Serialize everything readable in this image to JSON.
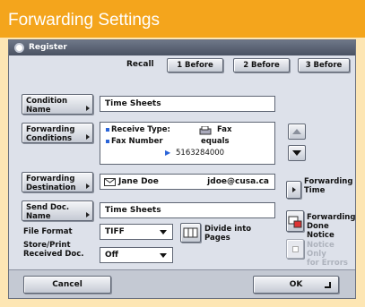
{
  "page_title": "Forwarding Settings",
  "window": {
    "title": "Register"
  },
  "recall": {
    "label": "Recall",
    "buttons": [
      "1 Before",
      "2 Before",
      "3 Before"
    ]
  },
  "condition_name": {
    "button": [
      "Condition",
      "Name"
    ],
    "value": "Time Sheets"
  },
  "forwarding_conditions": {
    "button": [
      "Forwarding",
      "Conditions"
    ],
    "receive_type_label": "Receive Type:",
    "receive_type_value": "Fax",
    "fax_number_label": "Fax Number",
    "fax_number_op": "equals",
    "fax_number_value": "5163284000"
  },
  "forwarding_destination": {
    "button": [
      "Forwarding",
      "Destination"
    ],
    "name": "Jane Doe",
    "email": "jdoe@cusa.ca"
  },
  "forwarding_time": {
    "label": [
      "Forwarding",
      "Time"
    ]
  },
  "send_doc_name": {
    "button": [
      "Send Doc.",
      "Name"
    ],
    "value": "Time Sheets"
  },
  "file_format": {
    "label": "File Format",
    "value": "TIFF"
  },
  "store_print": {
    "label": [
      "Store/Print",
      "Received Doc."
    ],
    "value": "Off"
  },
  "divide_pages": {
    "label": [
      "Divide into",
      "Pages"
    ]
  },
  "forwarding_done_notice": {
    "label": [
      "Forwarding",
      "Done Notice"
    ]
  },
  "notice_only_errors": {
    "label": [
      "Notice Only",
      "for Errors"
    ]
  },
  "footer": {
    "cancel": "Cancel",
    "ok": "OK"
  },
  "colors": {
    "title_bar": "#f4a51c",
    "background": "#fde6b4",
    "accent": "#2a64d8"
  }
}
